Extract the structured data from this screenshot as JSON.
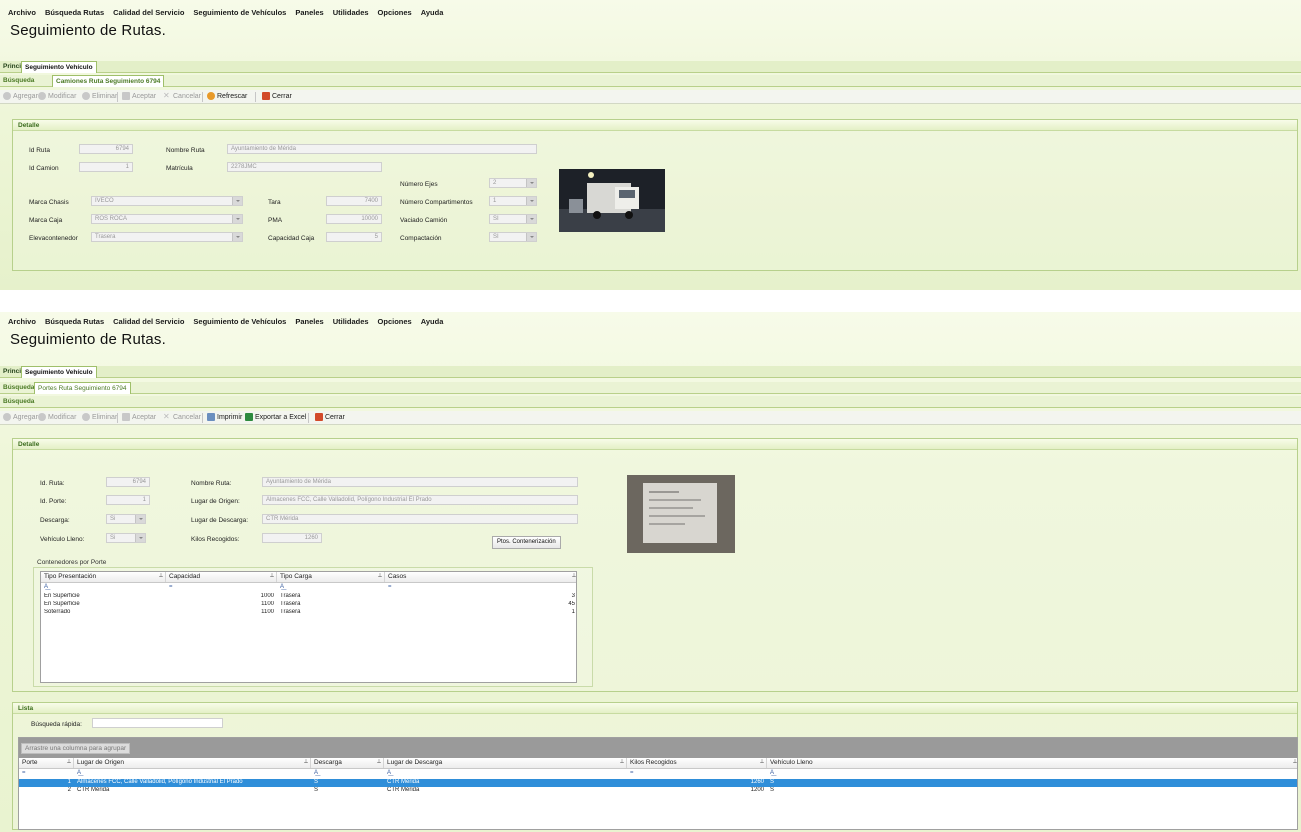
{
  "menu": [
    "Archivo",
    "Búsqueda Rutas",
    "Calidad del Servicio",
    "Seguimiento de Vehículos",
    "Paneles",
    "Utilidades",
    "Opciones",
    "Ayuda"
  ],
  "app_title": "Seguimiento de Rutas.",
  "screen1": {
    "top_tabs": [
      "Principal",
      "Seguimiento Vehículo"
    ],
    "sub_tabs": [
      "Búsqueda",
      "Camiones Ruta Seguimiento 6794"
    ],
    "toolbar": [
      "Agregar",
      "Modificar",
      "Eliminar",
      "Aceptar",
      "Cancelar",
      "Refrescar",
      "Cerrar"
    ],
    "section_title": "Detalle",
    "fields": {
      "id_ruta_label": "Id Ruta",
      "id_ruta": "6794",
      "id_camion_label": "Id Camion",
      "id_camion": "1",
      "nombre_ruta_label": "Nombre Ruta",
      "nombre_ruta": "Ayuntamiento de Mérida",
      "matricula_label": "Matrícula",
      "matricula": "2278JMC",
      "marca_chasis_label": "Marca Chasis",
      "marca_chasis": "IVECO",
      "marca_caja_label": "Marca Caja",
      "marca_caja": "ROS ROCA",
      "elevacontenedor_label": "Elevacontenedor",
      "elevacontenedor": "Trasera",
      "tara_label": "Tara",
      "tara": "7400",
      "pma_label": "PMA",
      "pma": "10000",
      "capacidad_caja_label": "Capacidad Caja",
      "capacidad_caja": "5",
      "numero_ejes_label": "Número Ejes",
      "numero_ejes": "2",
      "numero_compartimentos_label": "Número Compartimentos",
      "numero_compartimentos": "1",
      "vaciado_camion_label": "Vaciado Camión",
      "vaciado_camion": "SI",
      "compactacion_label": "Compactación",
      "compactacion": "SI"
    }
  },
  "screen2": {
    "top_tabs": [
      "Principal",
      "Seguimiento Vehículo"
    ],
    "sub_tabs": [
      "Búsqueda",
      "Portes Ruta Seguimiento 6794"
    ],
    "sub_tabs2": [
      "Búsqueda"
    ],
    "toolbar": [
      "Agregar",
      "Modificar",
      "Eliminar",
      "Aceptar",
      "Cancelar",
      "Imprimir",
      "Exportar a Excel",
      "Cerrar"
    ],
    "section_title": "Detalle",
    "fields": {
      "id_ruta_label": "Id. Ruta:",
      "id_ruta": "6794",
      "id_porte_label": "Id. Porte:",
      "id_porte": "1",
      "descarga_label": "Descarga:",
      "descarga": "Si",
      "vehiculo_lleno_label": "Vehículo Lleno:",
      "vehiculo_lleno": "Si",
      "nombre_ruta_label": "Nombre Ruta:",
      "nombre_ruta": "Ayuntamiento de Mérida",
      "lugar_origen_label": "Lugar de Origen:",
      "lugar_origen": "Almacenes FCC, Calle Valladolid, Polígono Industrial El Prado",
      "lugar_descarga_label": "Lugar de Descarga:",
      "lugar_descarga": "CTR Mérida",
      "kilos_label": "Kilos Recogidos:",
      "kilos": "1260"
    },
    "ptos_button": "Ptos. Contenerización",
    "contenedores_title": "Contenedores por Porte",
    "contenedores_columns": [
      "Tipo Presentación",
      "Capacidad",
      "Tipo Carga",
      "Casos"
    ],
    "contenedores_rows": [
      [
        "En Superficie",
        "1000",
        "Trasera",
        "3"
      ],
      [
        "En Superficie",
        "1100",
        "Trasera",
        "45"
      ],
      [
        "Soterrado",
        "1100",
        "Trasera",
        "1"
      ]
    ],
    "lista_title": "Lista",
    "busqueda_rapida_label": "Búsqueda rápida:",
    "group_hint": "Arrastre una columna para agrupar",
    "lista_columns": [
      "Porte",
      "Lugar de Origen",
      "Descarga",
      "Lugar de Descarga",
      "Kilos Recogidos",
      "Vehículo Lleno"
    ],
    "lista_rows": [
      [
        "1",
        "Almacenes FCC, Calle Valladolid, Polígono Industrial El Prado",
        "S",
        "CTR Mérida",
        "1260",
        "S"
      ],
      [
        "2",
        "CTR Mérida",
        "S",
        "CTR Mérida",
        "1200",
        "S"
      ]
    ]
  },
  "colors": {
    "accent_green": "#4b7a25",
    "selection": "#2f8ed9"
  }
}
